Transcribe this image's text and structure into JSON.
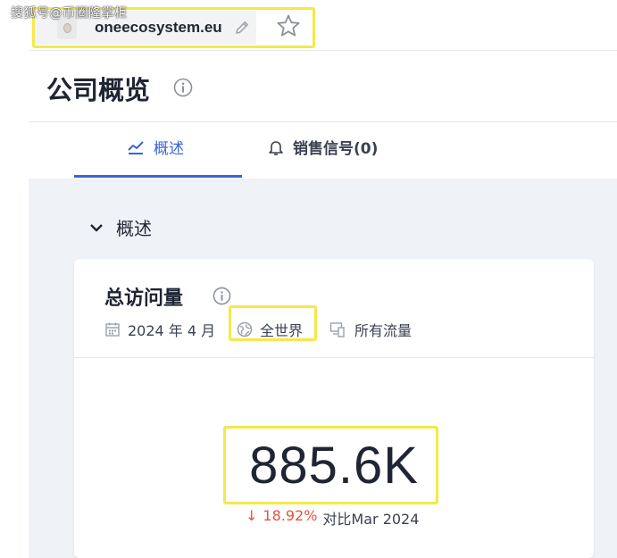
{
  "watermark": "搜狐号@币圈隆掌柜",
  "header": {
    "domain": "oneecosystem.eu"
  },
  "page": {
    "title": "公司概览"
  },
  "tabs": [
    {
      "label": "概述",
      "icon": "trend-line-icon",
      "active": true
    },
    {
      "label": "销售信号(0)",
      "icon": "bell-icon",
      "active": false
    }
  ],
  "section": {
    "title": "概述"
  },
  "card": {
    "title": "总访问量",
    "date": "2024 年 4 月",
    "region": "全世界",
    "traffic": "所有流量",
    "value": "885.6K",
    "change_value": "18.92%",
    "change_direction": "down",
    "change_arrow": "↓",
    "change_compare": "对比Mar 2024"
  },
  "colors": {
    "accent": "#3b63d8",
    "highlight": "#f4e84a",
    "negative": "#e5533f",
    "background": "#eff2f7"
  }
}
